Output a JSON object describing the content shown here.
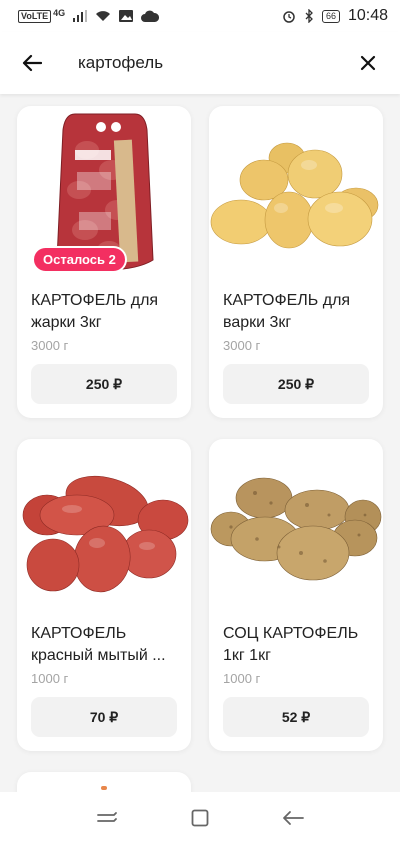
{
  "status_bar": {
    "volte": "VoLTE",
    "network": "4G",
    "battery": "66",
    "time": "10:48"
  },
  "search": {
    "query": "картофель"
  },
  "products": [
    {
      "name": "КАРТОФЕЛЬ для жарки 3кг",
      "weight": "3000 г",
      "price": "250 ₽",
      "badge": "Осталось 2",
      "image": "potato-net-bag-image"
    },
    {
      "name": "КАРТОФЕЛЬ для варки 3кг",
      "weight": "3000 г",
      "price": "250 ₽",
      "image": "yellow-potatoes-image"
    },
    {
      "name": "КАРТОФЕЛЬ красный мытый ...",
      "weight": "1000 г",
      "price": "70 ₽",
      "image": "red-potatoes-image"
    },
    {
      "name": "СОЦ КАРТОФЕЛЬ 1кг 1кг",
      "weight": "1000 г",
      "price": "52 ₽",
      "image": "brown-potatoes-image"
    }
  ],
  "icons": {
    "back": "arrow-left-icon",
    "clear": "close-icon",
    "nav_recents": "recents-icon",
    "nav_home": "home-icon",
    "nav_back": "back-icon"
  },
  "colors": {
    "badge": "#f32f61",
    "price_button": "#f2f2f2",
    "weight_text": "#a4a4a4"
  }
}
